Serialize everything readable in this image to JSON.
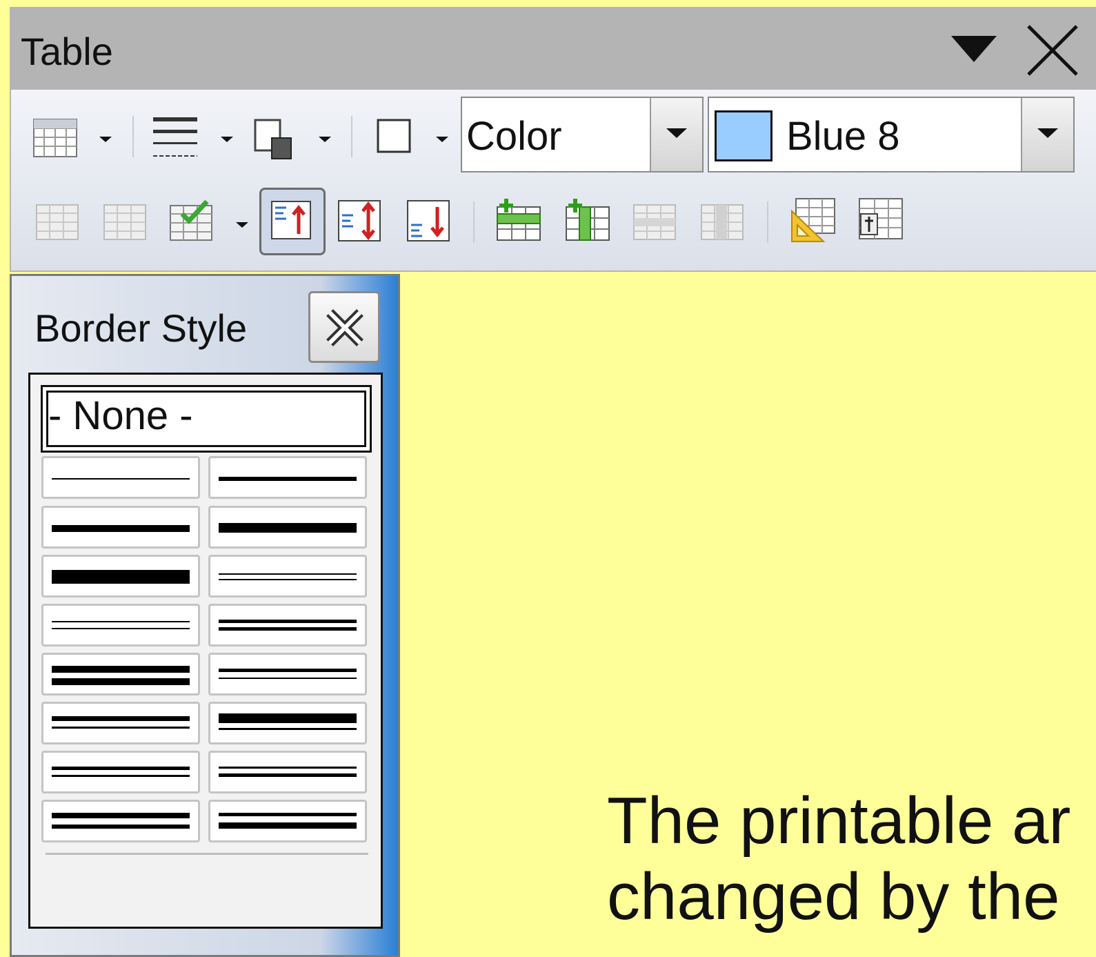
{
  "toolbar": {
    "title": "Table",
    "icons": [
      "table-icon",
      "borders-icon",
      "border-style-icon",
      "border-color-icon",
      "borders-box-icon",
      "merge-cells-icon",
      "split-cells-icon",
      "optimize-icon",
      "align-top-icon",
      "center-vertically-icon",
      "align-bottom-icon",
      "insert-rows-icon",
      "insert-columns-icon",
      "delete-rows-icon",
      "delete-columns-icon",
      "table-properties-icon",
      "number-format-icon"
    ],
    "area_fill_mode": "Color",
    "area_fill_color_name": "Blue 8",
    "area_fill_color": "#99ccff"
  },
  "border_style_panel": {
    "title": "Border Style",
    "none_label": "- None -"
  },
  "document": {
    "line1": "The printable ar",
    "line2": "changed by the"
  },
  "colors": {
    "page_background": "#ffff99",
    "selected_swatch": "#99ccff"
  }
}
